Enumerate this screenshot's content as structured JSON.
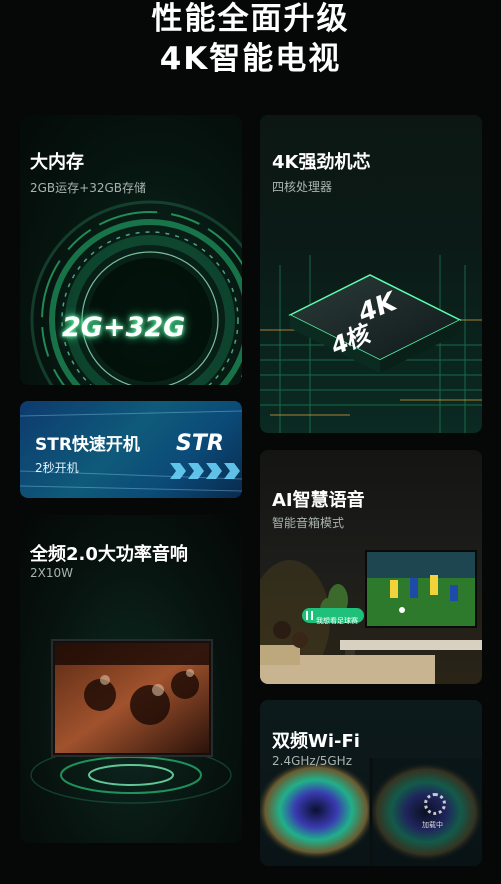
{
  "headline": {
    "line1": "性能全面升级",
    "line2": "4K智能电视"
  },
  "cards": {
    "memory": {
      "title": "大内存",
      "subtitle": "2GB运存+32GB存储",
      "graphic_text": "2G+32G"
    },
    "chip": {
      "title": "4K强劲机芯",
      "subtitle": "四核处理器",
      "chip_line1": "4K",
      "chip_line2": "4核"
    },
    "str": {
      "title": "STR快速开机",
      "subtitle": "2秒开机",
      "badge": "STR"
    },
    "audio": {
      "title": "全频2.0大功率音响",
      "subtitle": "2X10W"
    },
    "ai": {
      "title": "AI智慧语音",
      "subtitle": "智能音箱模式",
      "bubble": "我想看足球赛"
    },
    "wifi": {
      "title": "双频Wi-Fi",
      "subtitle": "2.4GHz/5GHz",
      "loading": "加载中"
    }
  },
  "colors": {
    "glow_green": "#3cff9a",
    "str_blue": "#0f5a7a",
    "background": "#050807"
  }
}
